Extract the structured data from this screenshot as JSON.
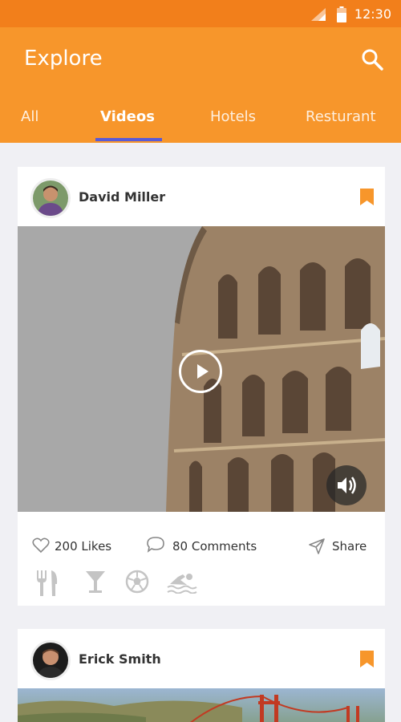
{
  "status_bar": {
    "time": "12:30"
  },
  "header": {
    "title": "Explore",
    "search_icon": "search-icon"
  },
  "tabs": [
    {
      "label": "All",
      "active": false
    },
    {
      "label": "Videos",
      "active": true
    },
    {
      "label": "Hotels",
      "active": false
    },
    {
      "label": "Resturant",
      "active": false
    }
  ],
  "posts": [
    {
      "author": "David Miller",
      "media": "video",
      "likes": "200 Likes",
      "comments": "80 Comments",
      "share": "Share",
      "categories": [
        "restaurant-icon",
        "bar-icon",
        "sports-icon",
        "swimming-icon"
      ]
    },
    {
      "author": "Erick Smith",
      "media": "image"
    }
  ],
  "colors": {
    "status_bar": "#f27f1b",
    "app_bar": "#f7962b",
    "tab_indicator": "#5a5ad6",
    "bookmark": "#f7962b"
  }
}
